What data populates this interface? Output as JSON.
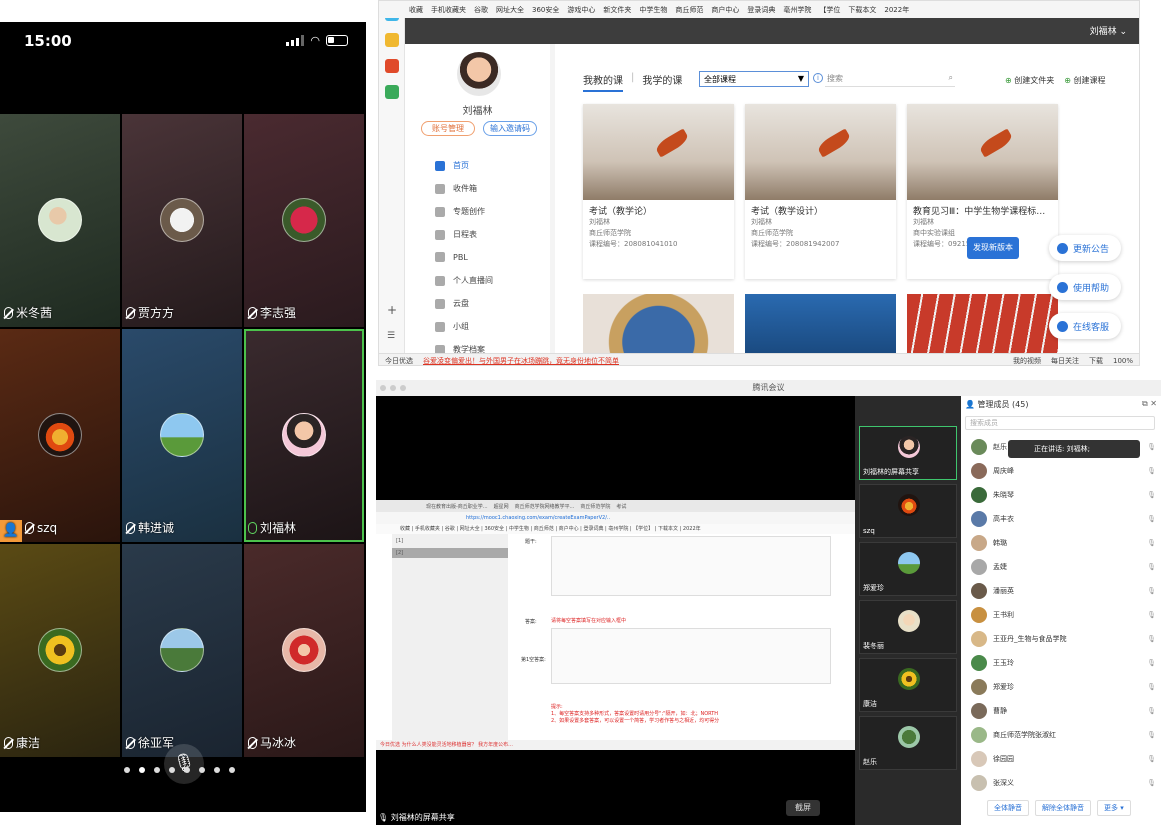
{
  "phone": {
    "time": "15:00",
    "participants": [
      {
        "name": "米冬茜",
        "mic": "off"
      },
      {
        "name": "贾方方",
        "mic": "off"
      },
      {
        "name": "李志强",
        "mic": "off"
      },
      {
        "name": "szq",
        "mic": "off"
      },
      {
        "name": "韩进诚",
        "mic": "off"
      },
      {
        "name": "刘福林",
        "mic": "on"
      },
      {
        "name": "康洁",
        "mic": "off"
      },
      {
        "name": "徐亚军",
        "mic": "off"
      },
      {
        "name": "马冰冰",
        "mic": "off"
      }
    ],
    "pages": 8,
    "current_page": 2
  },
  "browser": {
    "bookmarks": [
      "收藏",
      "手机收藏夹",
      "谷歌",
      "网址大全",
      "360安全",
      "游戏中心",
      "新文件夹",
      "中学生物",
      "商丘师范",
      "商户中心",
      "登录词典",
      "亳州学院",
      "【学位",
      "下载本文",
      "2022年"
    ],
    "user": "刘福林",
    "profile_name": "刘福林",
    "btn_account": "账号管理",
    "btn_invite": "输入邀请码",
    "nav": [
      "首页",
      "收件箱",
      "专题创作",
      "日程表",
      "PBL",
      "个人直播间",
      "云盘",
      "小组",
      "教学档案"
    ],
    "tab_teach": "我教的课",
    "tab_learn": "我学的课",
    "select_value": "全部课程",
    "search_placeholder": "搜索",
    "create_folder": "创建文件夹",
    "create_course": "创建课程",
    "courses": [
      {
        "title": "考试（教学论）",
        "teacher": "刘福林",
        "school": "商丘师范学院",
        "code": "课程编号：208081041010"
      },
      {
        "title": "考试（教学设计）",
        "teacher": "刘福林",
        "school": "商丘师范学院",
        "code": "课程编号：208081942007"
      },
      {
        "title": "教育见习Ⅲ：中学生物学课程标准...",
        "teacher": "刘福林",
        "school": "商中实验课组",
        "code": "课程编号：09215042"
      }
    ],
    "new_version": "发现新版本",
    "side_buttons": [
      "更新公告",
      "使用帮助",
      "在线客服"
    ],
    "status_left": "今日优选",
    "status_news": "谷爱凌变偏爱出！与外国男子在冰场蹦跳，竟无身份地位不简单",
    "status_right": [
      "我的视频",
      "每日关注",
      "下载",
      "100%"
    ]
  },
  "meeting": {
    "window_title": "腾讯会议",
    "share_label": "刘福林的屏幕共享",
    "fullscreen": "截屏",
    "inner": {
      "tabs": [
        "现在教育出版-商丘职业学...",
        "超星网",
        "商丘师范学院网络教学平...",
        "商丘师范学院",
        "考试"
      ],
      "url": "https://mooc1.chaoxing.com/exam/createExamPaperV2/..",
      "favs": "收藏 | 手机收藏夹 | 谷歌 | 网址大全 | 360安全 | 中学生物 | 商丘师范 | 商户中心 | 登录词典 | 亳州学院 | 【学位】 | 下载本文 | 2022年",
      "list": [
        "[1]",
        "[2]"
      ],
      "q_label": "题干:",
      "a_label": "答案:",
      "a_hint": "请将每空答案填写在对应输入框中",
      "blank_label": "第1空答案:",
      "tips_title": "提示:",
      "tip1": "1、每空答案支持多种形式，答案设置时请用分号\";\"隔开，如：北；NORTH",
      "tip2": "2、如果设置多套答案，可以设置一个简答，学习者作答与之相近，均可得分",
      "status": "今日优选  为什么人类没能灵活地移植器官？ 我方年度公布..."
    },
    "video_tiles": [
      {
        "label": "刘福林的屏幕共享"
      },
      {
        "label": "szq"
      },
      {
        "label": "郑爱珍"
      },
      {
        "label": "裴冬丽"
      },
      {
        "label": "康洁"
      },
      {
        "label": "赵乐"
      }
    ],
    "members_header": "管理成员 (45)",
    "members_search": "搜索成员",
    "speaking": "正在讲话: 刘福林;",
    "members": [
      "赵乐",
      "周庆峰",
      "朱晓琴",
      "高丰衣",
      "韩璐",
      "孟婕",
      "潘丽英",
      "王书利",
      "王亚丹_生物与食品学院",
      "王玉玲",
      "郑爱珍",
      "曹静",
      "商丘师范学院张淑红",
      "徐园园",
      "张深义"
    ],
    "btn_mute_all": "全体静音",
    "btn_unmute_all": "解除全体静音",
    "btn_more": "更多"
  }
}
